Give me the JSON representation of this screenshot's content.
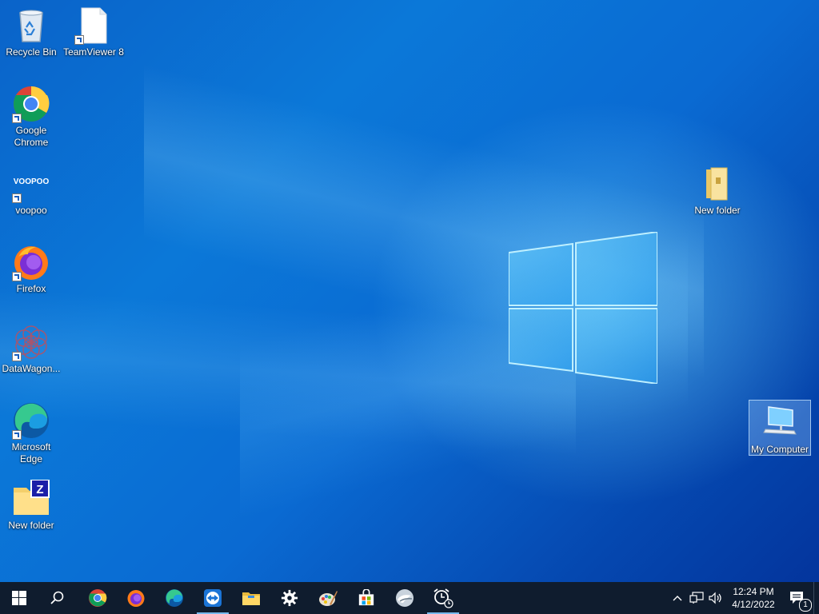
{
  "desktop": {
    "icons": [
      {
        "label": "Recycle Bin",
        "icon": "recycle-bin-icon"
      },
      {
        "label": "TeamViewer 8",
        "icon": "document-icon"
      },
      {
        "label": "Google Chrome",
        "icon": "chrome-icon"
      },
      {
        "label": "voopoo",
        "icon": "voopoo-icon",
        "logo_text": "VOOPOO"
      },
      {
        "label": "Firefox",
        "icon": "firefox-icon"
      },
      {
        "label": "DataWagon...",
        "icon": "datawagon-icon"
      },
      {
        "label": "Microsoft Edge",
        "icon": "edge-icon"
      },
      {
        "label": "New folder",
        "icon": "zipped-folder-icon"
      },
      {
        "label": "New folder",
        "icon": "folder-icon"
      },
      {
        "label": "My Computer",
        "icon": "computer-icon"
      }
    ]
  },
  "taskbar": {
    "start": "windows-start-icon",
    "search": "search-icon",
    "apps": [
      {
        "name": "Google Chrome",
        "icon": "chrome-icon"
      },
      {
        "name": "Firefox",
        "icon": "firefox-icon"
      },
      {
        "name": "Microsoft Edge",
        "icon": "edge-icon"
      },
      {
        "name": "TeamViewer",
        "icon": "teamviewer-icon"
      },
      {
        "name": "File Explorer",
        "icon": "file-explorer-icon"
      },
      {
        "name": "Settings",
        "icon": "gear-icon"
      },
      {
        "name": "Paint",
        "icon": "paint-icon"
      },
      {
        "name": "Microsoft Store",
        "icon": "store-icon"
      },
      {
        "name": "App",
        "icon": "app-icon"
      },
      {
        "name": "Alarms & Clock",
        "icon": "alarm-clock-icon"
      }
    ],
    "tray": {
      "time": "12:24 PM",
      "date": "4/12/2022",
      "notification_count": "1"
    }
  },
  "colors": {
    "taskbar": "#0f1c2e",
    "accent": "#76b9ed",
    "desktop": "#0a6ad2"
  }
}
